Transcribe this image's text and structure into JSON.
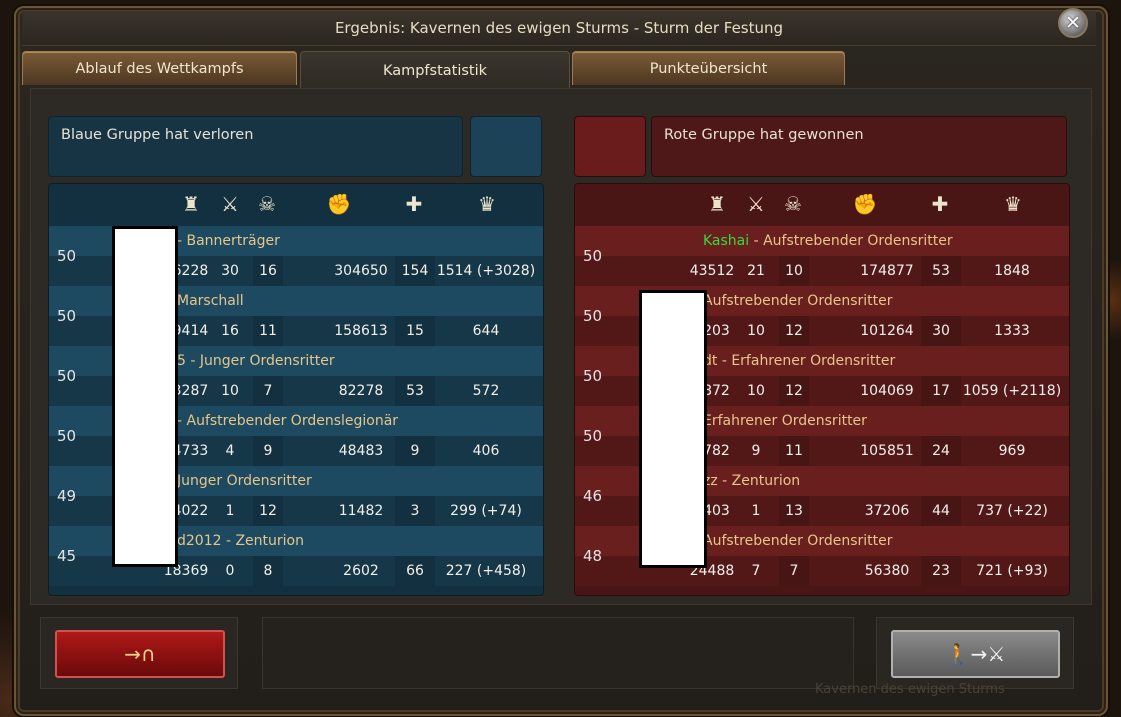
{
  "window": {
    "title": "Ergebnis: Kavernen des ewigen Sturms - Sturm der Festung"
  },
  "tabs": [
    {
      "label": "Ablauf des Wettkampfs",
      "active": false
    },
    {
      "label": "Kampfstatistik",
      "active": true
    },
    {
      "label": "Punkteübersicht",
      "active": false
    }
  ],
  "blue": {
    "status": "Blaue Gruppe hat verloren",
    "color": "#173444",
    "header_icons": [
      "tower-icon",
      "swords-icon",
      "skull-icon",
      "fist-icon",
      "plus-icon",
      "crown-icon"
    ],
    "rows": [
      {
        "level": "50",
        "name": "- Bannerträger",
        "c1": "36228",
        "c2": "30",
        "c3": "16",
        "c4": "304650",
        "c5": "154",
        "c6": "1514 (+3028)"
      },
      {
        "level": "50",
        "name": "Marschall",
        "c1": "29414",
        "c2": "16",
        "c3": "11",
        "c4": "158613",
        "c5": "15",
        "c6": "644"
      },
      {
        "level": "50",
        "name": "5 - Junger Ordensritter",
        "c1": "33287",
        "c2": "10",
        "c3": "7",
        "c4": "82278",
        "c5": "53",
        "c6": "572"
      },
      {
        "level": "50",
        "name": "- Aufstrebender Ordenslegionär",
        "c1": "34733",
        "c2": "4",
        "c3": "9",
        "c4": "48483",
        "c5": "9",
        "c6": "406"
      },
      {
        "level": "49",
        "name": "Junger Ordensritter",
        "c1": "74022",
        "c2": "1",
        "c3": "12",
        "c4": "11482",
        "c5": "3",
        "c6": "299 (+74)"
      },
      {
        "level": "45",
        "name": "d2012 - Zenturion",
        "c1": "18369",
        "c2": "0",
        "c3": "8",
        "c4": "2602",
        "c5": "66",
        "c6": "227 (+458)"
      }
    ]
  },
  "red": {
    "status": "Rote Gruppe hat gewonnen",
    "color": "#4e1818",
    "rows": [
      {
        "level": "50",
        "highlight": "Kashai",
        "name": " - Aufstrebender Ordensritter",
        "c1": "43512",
        "c2": "21",
        "c3": "10",
        "c4": "174877",
        "c5": "53",
        "c6": "1848"
      },
      {
        "level": "50",
        "highlight": "",
        "name": "Aufstrebender Ordensritter",
        "c1": "3203",
        "c2": "10",
        "c3": "12",
        "c4": "101264",
        "c5": "30",
        "c6": "1333"
      },
      {
        "level": "50",
        "highlight": "",
        "name": "dt - Erfahrener Ordensritter",
        "c1": "3872",
        "c2": "10",
        "c3": "12",
        "c4": "104069",
        "c5": "17",
        "c6": "1059 (+2118)"
      },
      {
        "level": "50",
        "highlight": "",
        "name": "Erfahrener Ordensritter",
        "c1": "4782",
        "c2": "9",
        "c3": "11",
        "c4": "105851",
        "c5": "24",
        "c6": "969"
      },
      {
        "level": "46",
        "highlight": "",
        "name": "zz - Zenturion",
        "c1": "3403",
        "c2": "1",
        "c3": "13",
        "c4": "37206",
        "c5": "44",
        "c6": "737 (+22)"
      },
      {
        "level": "48",
        "highlight": "",
        "name": "Aufstrebender Ordensritter",
        "c1": "24488",
        "c2": "7",
        "c3": "7",
        "c4": "56380",
        "c5": "23",
        "c6": "721 (+93)"
      }
    ]
  },
  "buttons": {
    "leave_icon": "arrow-gate-icon",
    "leave_label": "→∩",
    "spectate_icon": "person-arrow-swords-icon",
    "spectate_label": "🚶→⚔"
  },
  "close_label": "✕",
  "ghost_text": "Kavernen des ewigen Sturms"
}
